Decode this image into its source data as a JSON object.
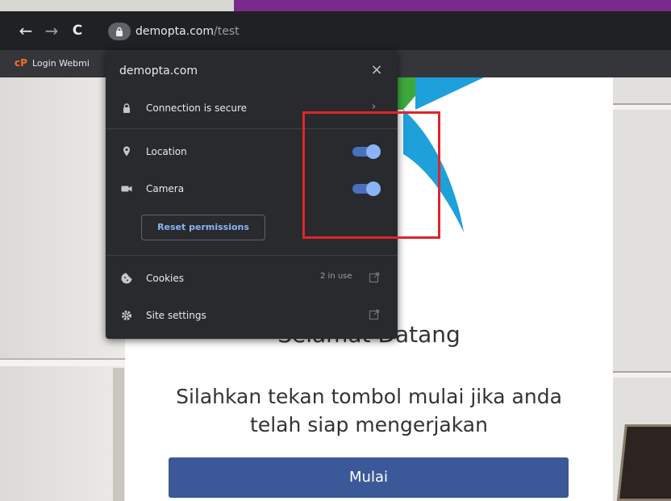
{
  "browser": {
    "url_domain": "demopta.com",
    "url_path": "/test",
    "back_glyph": "←",
    "forward_glyph": "→",
    "reload_glyph": "C",
    "bookmark_icon_text": "cP",
    "bookmark_label": "Login Webmi"
  },
  "popup": {
    "title": "demopta.com",
    "close_glyph": "×",
    "connection_label": "Connection is secure",
    "connection_chevron": "›",
    "permissions": [
      {
        "label": "Location",
        "enabled": true,
        "icon": "location-pin-icon"
      },
      {
        "label": "Camera",
        "enabled": true,
        "icon": "camera-icon"
      }
    ],
    "reset_label": "Reset permissions",
    "cookies_label": "Cookies",
    "cookies_count": "2 in use",
    "site_settings_label": "Site settings",
    "accent_color": "#8ab4f8"
  },
  "page": {
    "welcome": "Selamat Datang",
    "subtitle": "Silahkan tekan tombol mulai jika anda telah siap mengerjakan",
    "start_label": "Mulai",
    "button_color": "#3b5998"
  },
  "annotation": {
    "color": "#e0242b"
  }
}
